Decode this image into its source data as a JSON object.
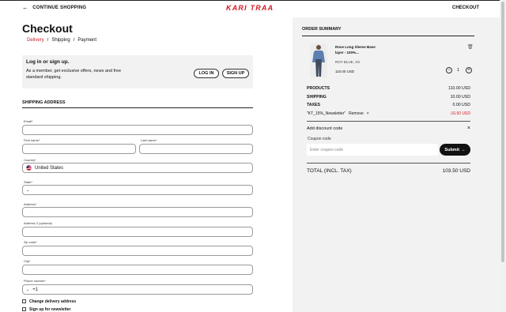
{
  "header": {
    "continue_label": "CONTINUE SHOPPING",
    "logo": "KARI TRAA",
    "checkout_label": "CHECKOUT"
  },
  "page": {
    "title": "Checkout",
    "breadcrumbs": [
      "Delivery",
      "Shipping",
      "Payment"
    ]
  },
  "login": {
    "title": "Log in or sign up.",
    "description": "As a member, get exclusive offers, news and free standard shipping.",
    "login_label": "LOG IN",
    "signup_label": "SIGN UP"
  },
  "shipping": {
    "heading": "SHIPPING ADDRESS",
    "email_label": "Email*",
    "first_name_label": "First name*",
    "last_name_label": "Last name*",
    "country_label": "Country*",
    "country_value": "United States",
    "state_label": "State*",
    "address_label": "Address*",
    "address2_label": "Address 2 (optional)",
    "zip_label": "Zip code*",
    "city_label": "City*",
    "phone_label": "Phone number*",
    "phone_prefix": "+1",
    "change_delivery_label": "Change delivery address",
    "newsletter_label": "Sign up for newsletter"
  },
  "summary": {
    "heading": "ORDER SUMMARY",
    "product": {
      "name": "Rose Long Sleeve Base layer - 100%...",
      "variant": "ROY BLUE, XS",
      "price": "110.00 USD",
      "quantity": "1"
    },
    "rows": [
      {
        "label": "PRODUCTS",
        "value": "110.00 USD"
      },
      {
        "label": "SHIPPING",
        "value": "10.00 USD"
      },
      {
        "label": "TAXES",
        "value": "0.00 USD"
      }
    ],
    "discount": {
      "code": "\"KT_15%_Newsletter\"",
      "remove_label": "Remove",
      "amount": "-16.50 USD"
    },
    "add_discount_label": "Add discount code",
    "coupon_label": "Coupon code",
    "coupon_placeholder": "Enter coupon code",
    "submit_label": "Submit",
    "total_label": "TOTAL (INCL. TAX)",
    "total_value": "103.50 USD"
  },
  "colors": {
    "brand": "#d11a24",
    "panel": "#f2f2f2",
    "button_dark": "#111111"
  }
}
